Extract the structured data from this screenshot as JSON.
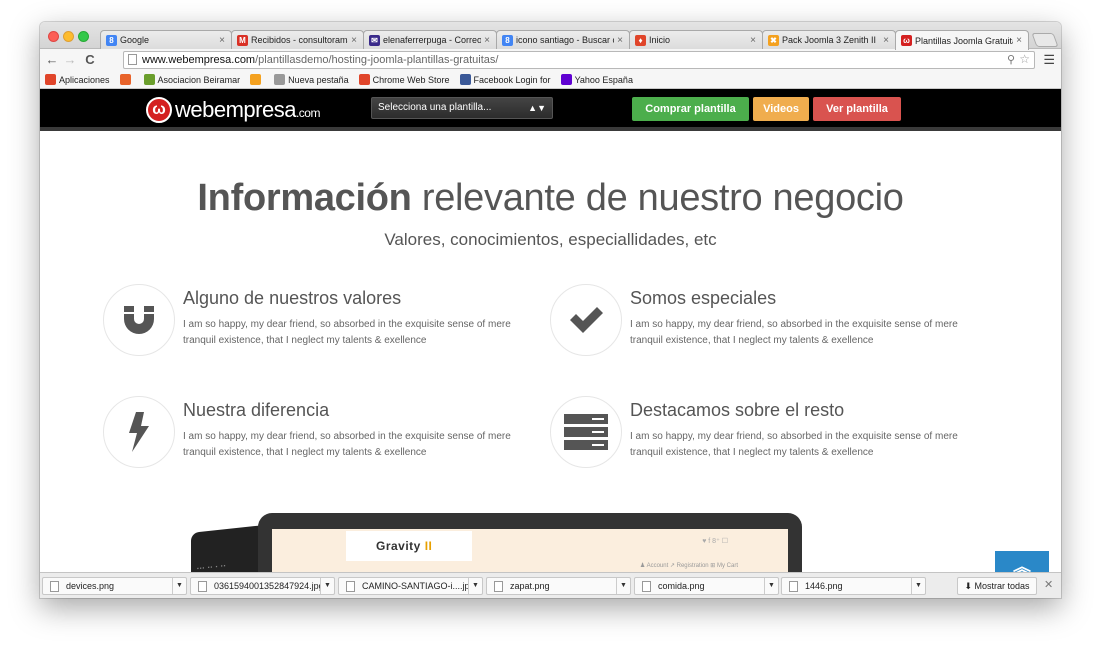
{
  "browser": {
    "tabs": [
      {
        "title": "Google",
        "icon": "google-icon",
        "color": "#4285f4",
        "glyph": "8"
      },
      {
        "title": "Recibidos - consultorama",
        "icon": "gmail-icon",
        "color": "#d93025",
        "glyph": "M"
      },
      {
        "title": "elenaferrerpuga - Correo",
        "icon": "mail-icon",
        "color": "#3a2a8a",
        "glyph": "✉"
      },
      {
        "title": "icono santiago - Buscar c",
        "icon": "google-icon",
        "color": "#4285f4",
        "glyph": "8"
      },
      {
        "title": "Inicio",
        "icon": "flame-icon",
        "color": "#e0452a",
        "glyph": "♦"
      },
      {
        "title": "Pack Joomla 3 Zenith II",
        "icon": "joomla-icon",
        "color": "#f4a11f",
        "glyph": "✖"
      },
      {
        "title": "Plantillas Joomla Gratuita",
        "icon": "webempresa-icon",
        "color": "#d42020",
        "glyph": "ω"
      }
    ],
    "url_host": "www.webempresa.com",
    "url_path": "/plantillasdemo/hosting-joomla-plantillas-gratuitas/",
    "bookmarks": [
      {
        "label": "Aplicaciones",
        "icon": "apps-grid-icon",
        "color": "#e0452a"
      },
      {
        "label": "",
        "icon": "mail-icon",
        "color": "#e8632a"
      },
      {
        "label": "Asociacion Beiramar",
        "icon": "play-icon",
        "color": "#6a9e2c"
      },
      {
        "label": "",
        "icon": "joomla-icon",
        "color": "#f4a11f"
      },
      {
        "label": "Nueva pestaña",
        "icon": "page-icon",
        "color": "#999999"
      },
      {
        "label": "Chrome Web Store",
        "icon": "chrome-store-icon",
        "color": "#e0452a"
      },
      {
        "label": "Facebook Login for",
        "icon": "facebook-icon",
        "color": "#3b5998"
      },
      {
        "label": "Yahoo España",
        "icon": "yahoo-icon",
        "color": "#5f01d1"
      }
    ]
  },
  "site": {
    "logo_text": "webempresa",
    "logo_tld": ".com",
    "select_label": "Selecciona una plantilla...",
    "buttons": {
      "buy": "Comprar plantilla",
      "videos": "Videos",
      "view": "Ver plantilla"
    },
    "hero_title_bold": "Información",
    "hero_title_rest": " relevante de nuestro negocio",
    "hero_subtitle": "Valores, conocimientos, especiallidades, etc",
    "features": [
      {
        "title": "Alguno de nuestros valores",
        "desc": "I am so happy, my dear friend, so absorbed in the exquisite sense of mere tranquil existence, that I neglect my talents & exellence",
        "icon": "magnet-icon"
      },
      {
        "title": "Somos especiales",
        "desc": "I am so happy, my dear friend, so absorbed in the exquisite sense of mere tranquil existence, that I neglect my talents & exellence",
        "icon": "checkmark-icon"
      },
      {
        "title": "Nuestra diferencia",
        "desc": "I am so happy, my dear friend, so absorbed in the exquisite sense of mere tranquil existence, that I neglect my talents & exellence",
        "icon": "lightning-icon"
      },
      {
        "title": "Destacamos sobre el resto",
        "desc": "I am so happy, my dear friend, so absorbed in the exquisite sense of mere tranquil existence, that I neglect my talents & exellence",
        "icon": "server-stack-icon"
      }
    ],
    "preview": {
      "brand": "Gravity",
      "brand_suffix": " II",
      "links": "♟ Account   ↗ Registration   ⊞ My Cart",
      "social": "♥ f 8⁺ ☐"
    }
  },
  "downloads": {
    "items": [
      "devices.png",
      "0361594001352847924.jpg",
      "CAMINO-SANTIAGO-i....jpg",
      "zapat.png",
      "comida.png",
      "1446.png"
    ],
    "show_all": "Mostrar todas"
  },
  "colors": {
    "green": "#4cae4c",
    "orange": "#f0ad4e",
    "red": "#d9534f",
    "blue": "#2a88c8",
    "brand": "#d42020"
  }
}
